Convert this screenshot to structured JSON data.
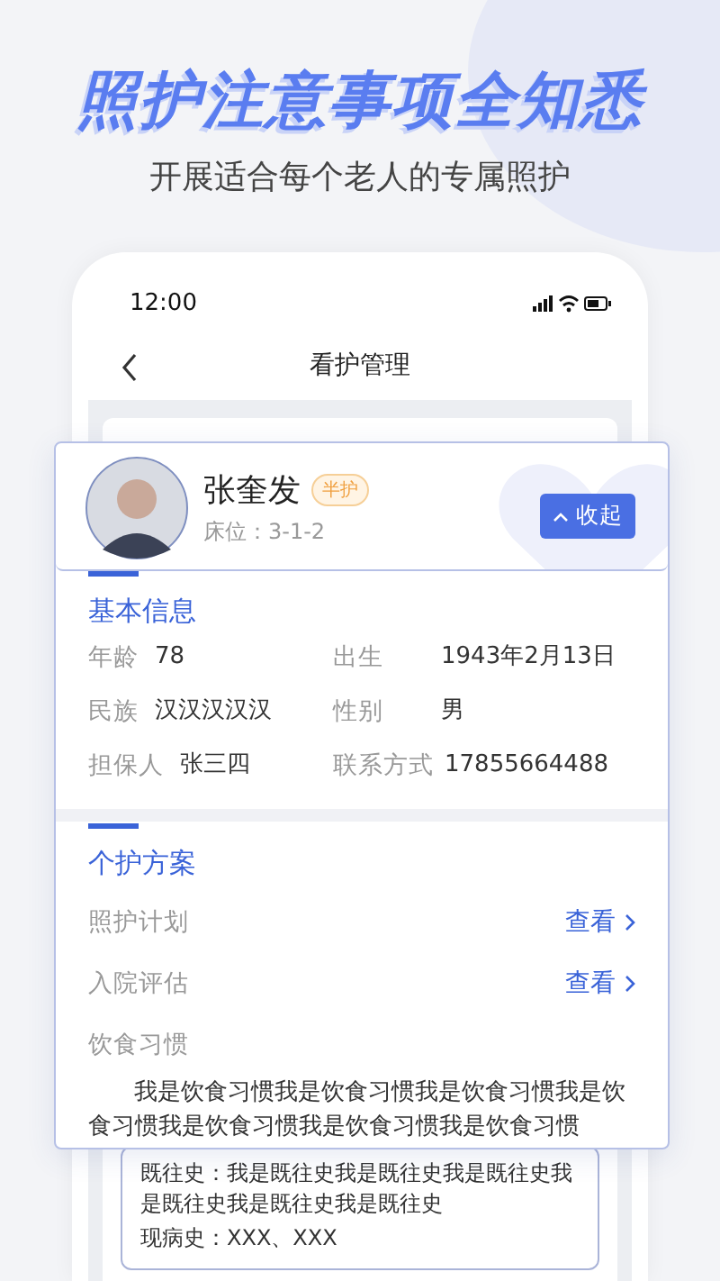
{
  "headline": "照护注意事项全知悉",
  "subtitle": "开展适合每个老人的专属照护",
  "phone": {
    "status_bar": {
      "time": "12:00"
    },
    "nav": {
      "title": "看护管理"
    }
  },
  "resident": {
    "name": "张奎发",
    "care_level": "半护",
    "bed": "床位：3-1-2",
    "collapse_button": "收起"
  },
  "basic_info": {
    "title": "基本信息",
    "fields": [
      {
        "label": "年龄",
        "value": "78"
      },
      {
        "label": "出生",
        "value": "1943年2月13日"
      },
      {
        "label": "民族",
        "value": "汉汉汉汉汉"
      },
      {
        "label": "性别",
        "value": "男"
      },
      {
        "label": "担保人",
        "value": "张三四"
      },
      {
        "label": "联系方式",
        "value": "17855664488"
      }
    ]
  },
  "care_plan": {
    "title": "个护方案",
    "links": [
      {
        "label": "照护计划",
        "action": "查看"
      },
      {
        "label": "入院评估",
        "action": "查看"
      }
    ],
    "diet": {
      "label": "饮食习惯",
      "text": "我是饮食习惯我是饮食习惯我是饮食习惯我是饮食习惯我是饮食习惯我是饮食习惯我是饮食习惯"
    }
  },
  "history": [
    {
      "label": "既往史：",
      "text": "我是既往史我是既往史我是既往史我是既往史我是既往史我是既往史"
    },
    {
      "label": "现病史：",
      "text": "XXX、XXX"
    }
  ]
}
